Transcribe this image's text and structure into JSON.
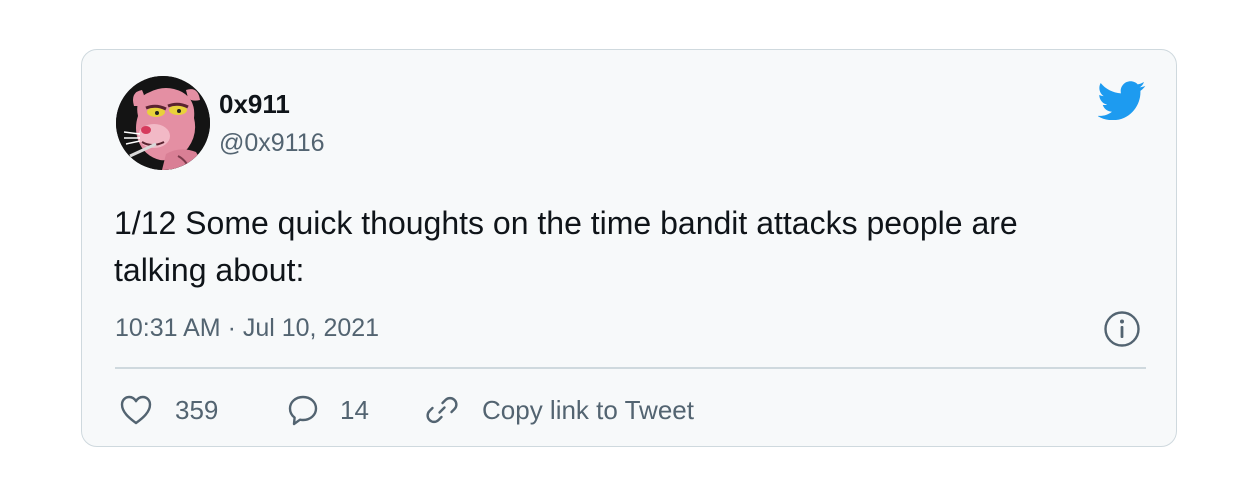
{
  "tweet": {
    "author": {
      "display_name": "0x911",
      "handle": "@0x9116",
      "avatar_icon": "pink-panther-avatar"
    },
    "brand_icon": "twitter-bird-icon",
    "brand_color": "#1d9bf0",
    "text": "1/12 Some quick thoughts on the time bandit attacks people are talking about:",
    "timestamp": "10:31 AM · Jul 10, 2021",
    "actions": {
      "likes": "359",
      "replies": "14",
      "copy_link_label": "Copy link to Tweet"
    }
  }
}
